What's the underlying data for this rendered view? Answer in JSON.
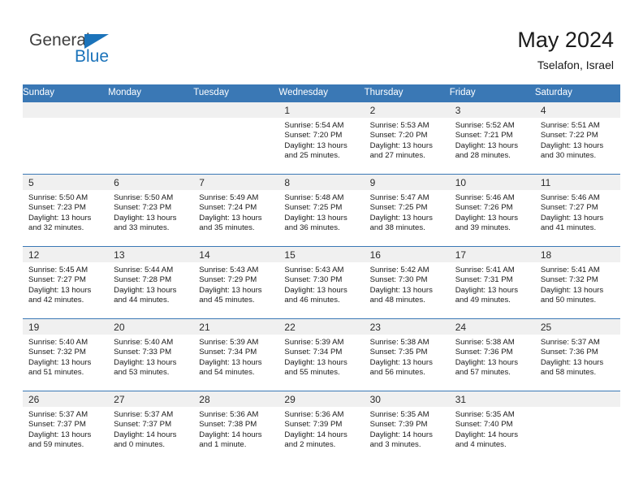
{
  "brand": {
    "name_top": "General",
    "name_bottom": "Blue",
    "triangle_color": "#1b73ba",
    "text_color": "#3f3f3f"
  },
  "header": {
    "title": "May 2024",
    "location": "Tselafon, Israel"
  },
  "theme": {
    "header_blue": "#3a78b5",
    "date_band_gray": "#f0f0f0",
    "text_dark": "#1a1a1a"
  },
  "weekday_headers": [
    "Sunday",
    "Monday",
    "Tuesday",
    "Wednesday",
    "Thursday",
    "Friday",
    "Saturday"
  ],
  "labels": {
    "sunrise_prefix": "Sunrise:",
    "sunset_prefix": "Sunset:",
    "daylight_prefix": "Daylight:"
  },
  "weeks": [
    [
      {
        "day": "",
        "sunrise": "",
        "sunset": "",
        "daylight_line1": "",
        "daylight_line2": ""
      },
      {
        "day": "",
        "sunrise": "",
        "sunset": "",
        "daylight_line1": "",
        "daylight_line2": ""
      },
      {
        "day": "",
        "sunrise": "",
        "sunset": "",
        "daylight_line1": "",
        "daylight_line2": ""
      },
      {
        "day": "1",
        "sunrise": "Sunrise: 5:54 AM",
        "sunset": "Sunset: 7:20 PM",
        "daylight_line1": "Daylight: 13 hours",
        "daylight_line2": "and 25 minutes."
      },
      {
        "day": "2",
        "sunrise": "Sunrise: 5:53 AM",
        "sunset": "Sunset: 7:20 PM",
        "daylight_line1": "Daylight: 13 hours",
        "daylight_line2": "and 27 minutes."
      },
      {
        "day": "3",
        "sunrise": "Sunrise: 5:52 AM",
        "sunset": "Sunset: 7:21 PM",
        "daylight_line1": "Daylight: 13 hours",
        "daylight_line2": "and 28 minutes."
      },
      {
        "day": "4",
        "sunrise": "Sunrise: 5:51 AM",
        "sunset": "Sunset: 7:22 PM",
        "daylight_line1": "Daylight: 13 hours",
        "daylight_line2": "and 30 minutes."
      }
    ],
    [
      {
        "day": "5",
        "sunrise": "Sunrise: 5:50 AM",
        "sunset": "Sunset: 7:23 PM",
        "daylight_line1": "Daylight: 13 hours",
        "daylight_line2": "and 32 minutes."
      },
      {
        "day": "6",
        "sunrise": "Sunrise: 5:50 AM",
        "sunset": "Sunset: 7:23 PM",
        "daylight_line1": "Daylight: 13 hours",
        "daylight_line2": "and 33 minutes."
      },
      {
        "day": "7",
        "sunrise": "Sunrise: 5:49 AM",
        "sunset": "Sunset: 7:24 PM",
        "daylight_line1": "Daylight: 13 hours",
        "daylight_line2": "and 35 minutes."
      },
      {
        "day": "8",
        "sunrise": "Sunrise: 5:48 AM",
        "sunset": "Sunset: 7:25 PM",
        "daylight_line1": "Daylight: 13 hours",
        "daylight_line2": "and 36 minutes."
      },
      {
        "day": "9",
        "sunrise": "Sunrise: 5:47 AM",
        "sunset": "Sunset: 7:25 PM",
        "daylight_line1": "Daylight: 13 hours",
        "daylight_line2": "and 38 minutes."
      },
      {
        "day": "10",
        "sunrise": "Sunrise: 5:46 AM",
        "sunset": "Sunset: 7:26 PM",
        "daylight_line1": "Daylight: 13 hours",
        "daylight_line2": "and 39 minutes."
      },
      {
        "day": "11",
        "sunrise": "Sunrise: 5:46 AM",
        "sunset": "Sunset: 7:27 PM",
        "daylight_line1": "Daylight: 13 hours",
        "daylight_line2": "and 41 minutes."
      }
    ],
    [
      {
        "day": "12",
        "sunrise": "Sunrise: 5:45 AM",
        "sunset": "Sunset: 7:27 PM",
        "daylight_line1": "Daylight: 13 hours",
        "daylight_line2": "and 42 minutes."
      },
      {
        "day": "13",
        "sunrise": "Sunrise: 5:44 AM",
        "sunset": "Sunset: 7:28 PM",
        "daylight_line1": "Daylight: 13 hours",
        "daylight_line2": "and 44 minutes."
      },
      {
        "day": "14",
        "sunrise": "Sunrise: 5:43 AM",
        "sunset": "Sunset: 7:29 PM",
        "daylight_line1": "Daylight: 13 hours",
        "daylight_line2": "and 45 minutes."
      },
      {
        "day": "15",
        "sunrise": "Sunrise: 5:43 AM",
        "sunset": "Sunset: 7:30 PM",
        "daylight_line1": "Daylight: 13 hours",
        "daylight_line2": "and 46 minutes."
      },
      {
        "day": "16",
        "sunrise": "Sunrise: 5:42 AM",
        "sunset": "Sunset: 7:30 PM",
        "daylight_line1": "Daylight: 13 hours",
        "daylight_line2": "and 48 minutes."
      },
      {
        "day": "17",
        "sunrise": "Sunrise: 5:41 AM",
        "sunset": "Sunset: 7:31 PM",
        "daylight_line1": "Daylight: 13 hours",
        "daylight_line2": "and 49 minutes."
      },
      {
        "day": "18",
        "sunrise": "Sunrise: 5:41 AM",
        "sunset": "Sunset: 7:32 PM",
        "daylight_line1": "Daylight: 13 hours",
        "daylight_line2": "and 50 minutes."
      }
    ],
    [
      {
        "day": "19",
        "sunrise": "Sunrise: 5:40 AM",
        "sunset": "Sunset: 7:32 PM",
        "daylight_line1": "Daylight: 13 hours",
        "daylight_line2": "and 51 minutes."
      },
      {
        "day": "20",
        "sunrise": "Sunrise: 5:40 AM",
        "sunset": "Sunset: 7:33 PM",
        "daylight_line1": "Daylight: 13 hours",
        "daylight_line2": "and 53 minutes."
      },
      {
        "day": "21",
        "sunrise": "Sunrise: 5:39 AM",
        "sunset": "Sunset: 7:34 PM",
        "daylight_line1": "Daylight: 13 hours",
        "daylight_line2": "and 54 minutes."
      },
      {
        "day": "22",
        "sunrise": "Sunrise: 5:39 AM",
        "sunset": "Sunset: 7:34 PM",
        "daylight_line1": "Daylight: 13 hours",
        "daylight_line2": "and 55 minutes."
      },
      {
        "day": "23",
        "sunrise": "Sunrise: 5:38 AM",
        "sunset": "Sunset: 7:35 PM",
        "daylight_line1": "Daylight: 13 hours",
        "daylight_line2": "and 56 minutes."
      },
      {
        "day": "24",
        "sunrise": "Sunrise: 5:38 AM",
        "sunset": "Sunset: 7:36 PM",
        "daylight_line1": "Daylight: 13 hours",
        "daylight_line2": "and 57 minutes."
      },
      {
        "day": "25",
        "sunrise": "Sunrise: 5:37 AM",
        "sunset": "Sunset: 7:36 PM",
        "daylight_line1": "Daylight: 13 hours",
        "daylight_line2": "and 58 minutes."
      }
    ],
    [
      {
        "day": "26",
        "sunrise": "Sunrise: 5:37 AM",
        "sunset": "Sunset: 7:37 PM",
        "daylight_line1": "Daylight: 13 hours",
        "daylight_line2": "and 59 minutes."
      },
      {
        "day": "27",
        "sunrise": "Sunrise: 5:37 AM",
        "sunset": "Sunset: 7:37 PM",
        "daylight_line1": "Daylight: 14 hours",
        "daylight_line2": "and 0 minutes."
      },
      {
        "day": "28",
        "sunrise": "Sunrise: 5:36 AM",
        "sunset": "Sunset: 7:38 PM",
        "daylight_line1": "Daylight: 14 hours",
        "daylight_line2": "and 1 minute."
      },
      {
        "day": "29",
        "sunrise": "Sunrise: 5:36 AM",
        "sunset": "Sunset: 7:39 PM",
        "daylight_line1": "Daylight: 14 hours",
        "daylight_line2": "and 2 minutes."
      },
      {
        "day": "30",
        "sunrise": "Sunrise: 5:35 AM",
        "sunset": "Sunset: 7:39 PM",
        "daylight_line1": "Daylight: 14 hours",
        "daylight_line2": "and 3 minutes."
      },
      {
        "day": "31",
        "sunrise": "Sunrise: 5:35 AM",
        "sunset": "Sunset: 7:40 PM",
        "daylight_line1": "Daylight: 14 hours",
        "daylight_line2": "and 4 minutes."
      },
      {
        "day": "",
        "sunrise": "",
        "sunset": "",
        "daylight_line1": "",
        "daylight_line2": ""
      }
    ]
  ]
}
